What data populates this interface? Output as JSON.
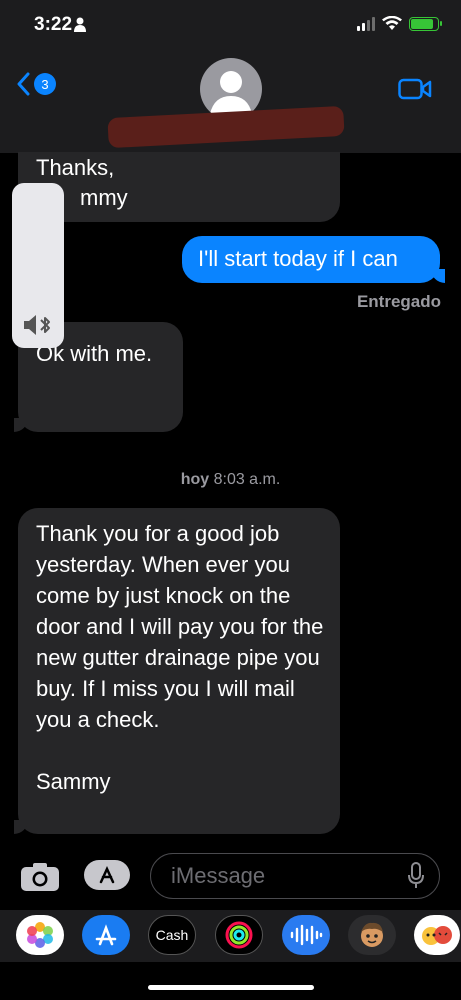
{
  "status_bar": {
    "time": "3:22"
  },
  "header": {
    "back_count": "3"
  },
  "messages": {
    "m1_line1": "Thanks,",
    "m1_line2": "mmy",
    "m2": "I'll start today if I can",
    "delivered": "Entregado",
    "m3": "k with me.",
    "m3_prefix": "O",
    "timestamp_day": "hoy",
    "timestamp_time": "8:03 a.m.",
    "m4": "Thank you for a good job yesterday.  When ever you come by just knock on the door and I will pay you for the new gutter drainage pipe you buy. If I miss you I will mail you a check.\n\nSammy"
  },
  "compose": {
    "placeholder": "iMessage"
  },
  "app_drawer": {
    "cash_label": "Cash"
  },
  "colors": {
    "accent": "#0a84ff",
    "bubble_gray": "#262628",
    "battery": "#37c537"
  }
}
